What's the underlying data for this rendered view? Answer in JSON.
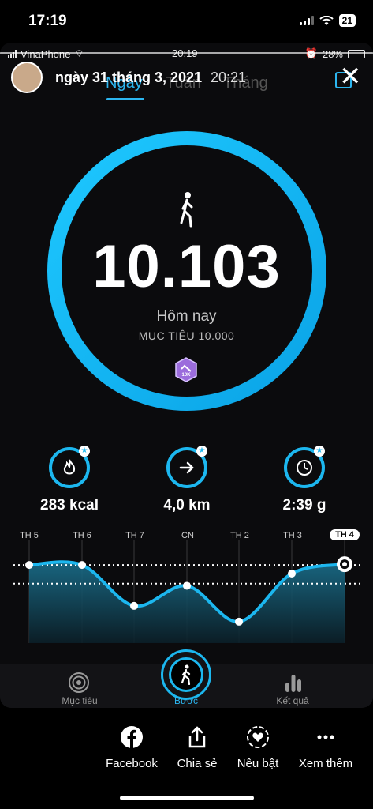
{
  "ios_status": {
    "time": "17:19",
    "battery": "21"
  },
  "inner_status": {
    "carrier": "VinaPhone",
    "time": "20:19",
    "battery": "28%"
  },
  "header": {
    "date": "ngày 31 tháng 3, 2021",
    "time": "20:21"
  },
  "tabs": [
    {
      "label": "Ngày",
      "active": true
    },
    {
      "label": "Tuần",
      "active": false
    },
    {
      "label": "Tháng",
      "active": false
    }
  ],
  "steps": {
    "count": "10.103",
    "label": "Hôm nay",
    "goal": "MỤC TIÊU 10.000",
    "badge": "10K",
    "progress": 1.0
  },
  "stats": [
    {
      "icon": "flame-icon",
      "value": "283 kcal"
    },
    {
      "icon": "arrow-right-icon",
      "value": "4,0 km"
    },
    {
      "icon": "clock-icon",
      "value": "2:39 g"
    }
  ],
  "chart_data": {
    "type": "area",
    "categories": [
      "TH 5",
      "TH 6",
      "TH 7",
      "CN",
      "TH 2",
      "TH 3",
      "TH 4"
    ],
    "series": [
      {
        "values": [
          10000,
          10000,
          4300,
          7100,
          2100,
          8800,
          10103
        ]
      }
    ],
    "ylim": [
      0,
      11000
    ],
    "reference_lines": [
      10000,
      7400
    ],
    "highlight_category": "TH 4",
    "colors": {
      "line": "#1cb7ef",
      "fill_top": "#1a6f8c",
      "fill_bottom": "#0b1f28"
    }
  },
  "bottom_nav": [
    {
      "label": "Mục tiêu",
      "icon": "target-icon",
      "active": false
    },
    {
      "label": "Bước",
      "icon": "walker-icon",
      "active": true
    },
    {
      "label": "Kết quả",
      "icon": "bar-chart-icon",
      "active": false
    }
  ],
  "share_actions": [
    {
      "label": "Facebook",
      "icon": "facebook-icon"
    },
    {
      "label": "Chia sẻ",
      "icon": "share-icon"
    },
    {
      "label": "Nêu bật",
      "icon": "heart-badge-icon"
    },
    {
      "label": "Xem thêm",
      "icon": "more-icon"
    }
  ],
  "colors": {
    "accent": "#1cb7ef",
    "background": "#000000"
  }
}
